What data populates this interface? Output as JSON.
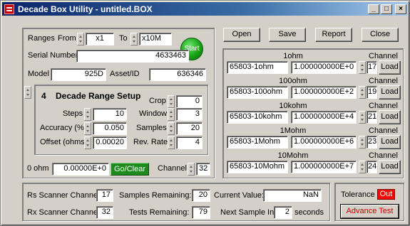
{
  "window": {
    "title": "Decade Box Utility - untitled.BOX",
    "controls": [
      "_",
      "□",
      "×"
    ]
  },
  "toolbar": {
    "open_label": "Open",
    "save_label": "Save",
    "report_label": "Report",
    "close_label": "Close"
  },
  "setup": {
    "ranges_label": "Ranges",
    "from_label": "From",
    "from_value": "x1",
    "to_label": "To",
    "to_value": "x10M",
    "start_label": "Start",
    "serial_label": "Serial Number",
    "serial_value": "4633463",
    "model_label": "Model",
    "model_value": "925D",
    "asset_label": "Asset/ID",
    "asset_value": "636346"
  },
  "range_setup": {
    "number": "4",
    "title": "Decade Range Setup",
    "steps_label": "Steps",
    "steps_value": "10",
    "accuracy_label": "Accuracy (%)",
    "accuracy_value": "0.050",
    "offset_label": "Offset (ohms)",
    "offset_value": "0.00020",
    "crop_label": "Crop",
    "crop_value": "0",
    "window_label": "Window",
    "window_value": "3",
    "samples_label": "Samples",
    "samples_value": "20",
    "rev_rate_label": "Rev. Rate",
    "rev_rate_value": "4"
  },
  "bottom_left": {
    "zero_label": "0 ohm",
    "zero_value": "0.00000E+0",
    "go_clear_label": "Go/Clear",
    "channel_label": "Channel",
    "channel_value": "32"
  },
  "decades": {
    "channel_header": "Channel",
    "load_label": "Load",
    "rows": [
      {
        "title": "1ohm",
        "name": "65803-1ohm",
        "value": "1.000000000E+0",
        "channel": "17"
      },
      {
        "title": "100ohm",
        "name": "65803-100ohm",
        "value": "1.000000000E+2",
        "channel": "19"
      },
      {
        "title": "10kohm",
        "name": "65803-10kohm",
        "value": "1.000000000E+4",
        "channel": "21"
      },
      {
        "title": "1Mohm",
        "name": "65803-1Mohm",
        "value": "1.000000000E+6",
        "channel": "23"
      },
      {
        "title": "10Mohm",
        "name": "65803-10Mohm",
        "value": "1.000000000E+7",
        "channel": "24"
      }
    ]
  },
  "status": {
    "rs_label": "Rs Scanner Channel",
    "rs_value": "17",
    "rx_label": "Rx Scanner Channel",
    "rx_value": "32",
    "samples_remaining_label": "Samples Remaining:",
    "samples_remaining_value": "20",
    "tests_remaining_label": "Tests Remaining:",
    "tests_remaining_value": "79",
    "current_value_label": "Current Value:",
    "current_value_value": "NaN",
    "next_sample_label": "Next Sample In:",
    "next_sample_value": "2",
    "next_sample_unit": "seconds",
    "tolerance_label": "Tolerance",
    "tolerance_status": "Out",
    "advance_test_label": "Advance Test"
  },
  "colors": {
    "title_gradient_start": "#0a246a",
    "start_green": "#16a316",
    "go_green": "#1d8a1d",
    "tolerance_red": "#ff0000",
    "advance_text_red": "#d00000"
  }
}
